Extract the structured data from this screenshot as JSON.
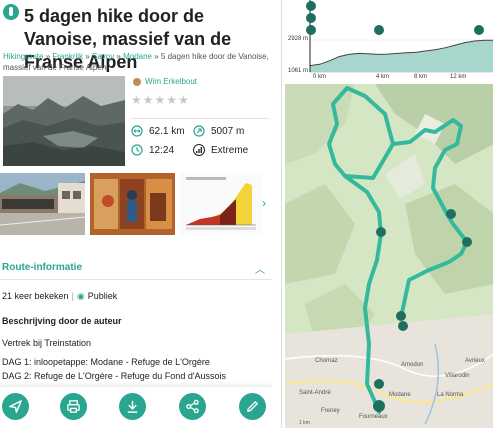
{
  "title": "5 dagen hike door de Vanoise, massief van de Franse Alpen",
  "breadcrumb": {
    "items": [
      "Hikingroute",
      "Frankrijk",
      "Savoy",
      "Modane"
    ],
    "current": "5 dagen hike door de Vanoise, massief van de Franse Alpen"
  },
  "author": {
    "name": "Wim Erkelbout"
  },
  "rating": {
    "stars": "★★★★★",
    "value_of_5": 0
  },
  "stats": {
    "distance": "62.1 km",
    "elevation": "5007 m",
    "duration": "12:24",
    "difficulty": "Extreme"
  },
  "route_section": {
    "title": "Route-informatie",
    "views": "21 keer bekeken",
    "visibility": "Publiek",
    "description_title": "Beschrijving door de auteur",
    "lines": [
      "Vertrek bij Treinstation",
      "DAG 1: inloopetappe: Modane - Refuge de L'Orgère",
      "DAG 2: Refuge de L'Orgère - Refuge du Fond d'Aussois"
    ]
  },
  "toolbar": {
    "buttons": [
      "navigate-icon",
      "print-icon",
      "download-icon",
      "share-icon",
      "edit-icon"
    ]
  },
  "elevation_profile": {
    "y_max_label": "2928 m",
    "y_min_label": "1061 m",
    "x_labels": [
      "0 km",
      "4 km",
      "8 km",
      "12 km"
    ],
    "profile": [
      0.2,
      0.24,
      0.35,
      0.48,
      0.55,
      0.58,
      0.57,
      0.55,
      0.56,
      0.58,
      0.6,
      0.62,
      0.66,
      0.7,
      0.76,
      0.84,
      0.92,
      0.97,
      0.99,
      0.99
    ]
  },
  "map": {
    "labels": [
      "Chornaz",
      "Saint-André",
      "Freney",
      "Fourneaux",
      "Modane",
      "Amodon",
      "Avrieux",
      "La Norma",
      "Villarodin"
    ],
    "scale": "1 km",
    "colors": {
      "route": "#34b99c",
      "accent": "#2aa58f"
    }
  }
}
